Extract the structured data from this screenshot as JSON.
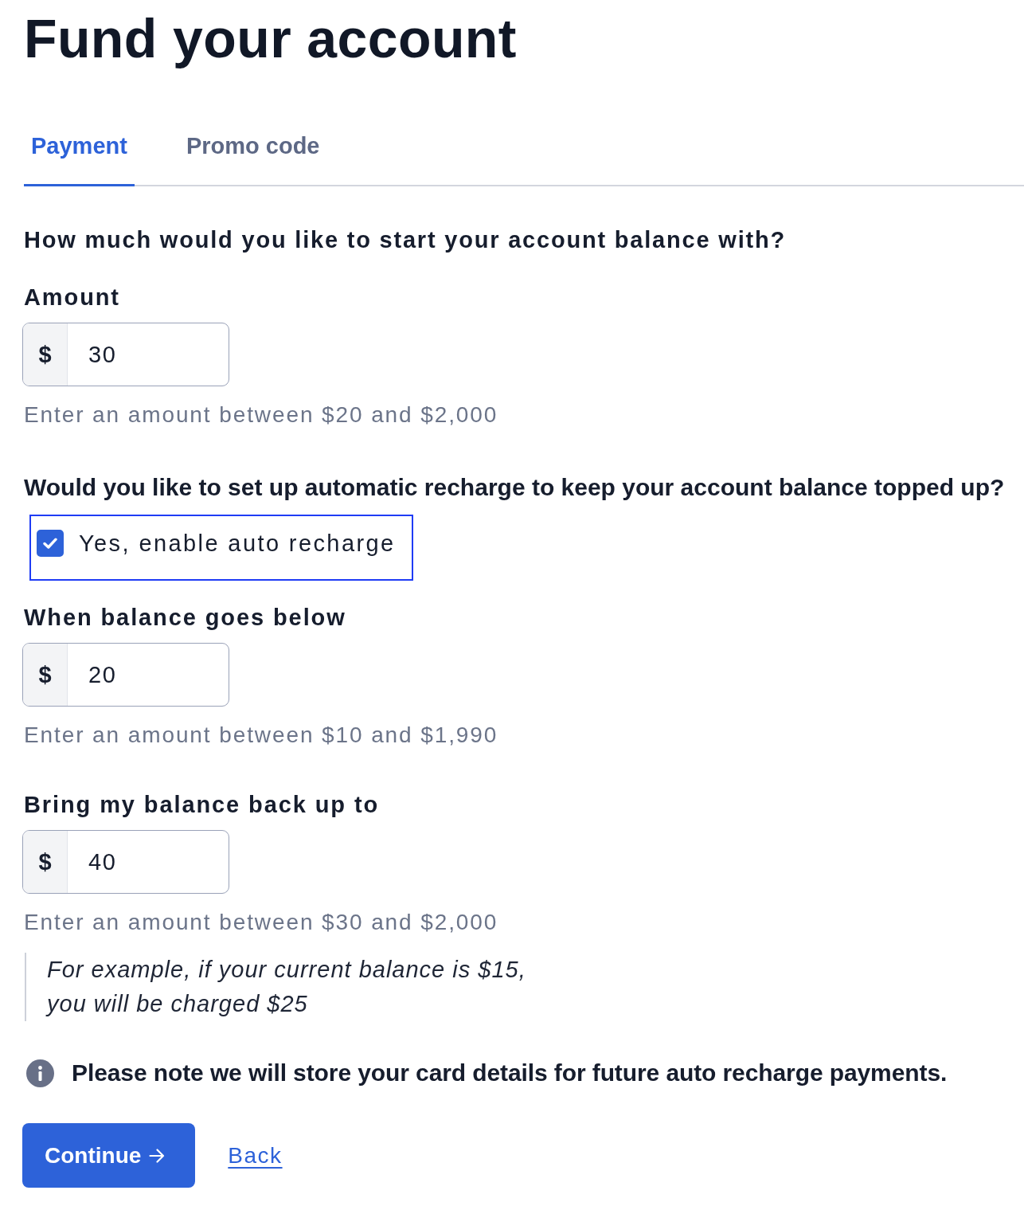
{
  "title": "Fund your account",
  "tabs": [
    {
      "label": "Payment",
      "selected": true
    },
    {
      "label": "Promo code",
      "selected": false
    }
  ],
  "balance": {
    "question": "How much would you like to start your account balance with?",
    "field": {
      "label": "Amount",
      "prefix": "$",
      "value": "30",
      "hint": "Enter an amount between $20 and $2,000"
    }
  },
  "auto_recharge": {
    "question": "Would you like to set up automatic recharge to keep your account balance topped up?",
    "checkbox": {
      "label": "Yes, enable auto recharge",
      "checked": true,
      "focused": true
    },
    "fields": [
      {
        "label": "When balance goes below",
        "prefix": "$",
        "value": "20",
        "hint": "Enter an amount between $10 and $1,990"
      },
      {
        "label": "Bring my balance back up to",
        "prefix": "$",
        "value": "40",
        "hint": "Enter an amount between $30 and $2,000"
      }
    ],
    "example": "For example, if your current balance is $15,\nyou will be charged $25"
  },
  "notice": "Please note we will store your card details for future auto recharge payments.",
  "actions": {
    "continue": "Continue",
    "back": "Back"
  }
}
